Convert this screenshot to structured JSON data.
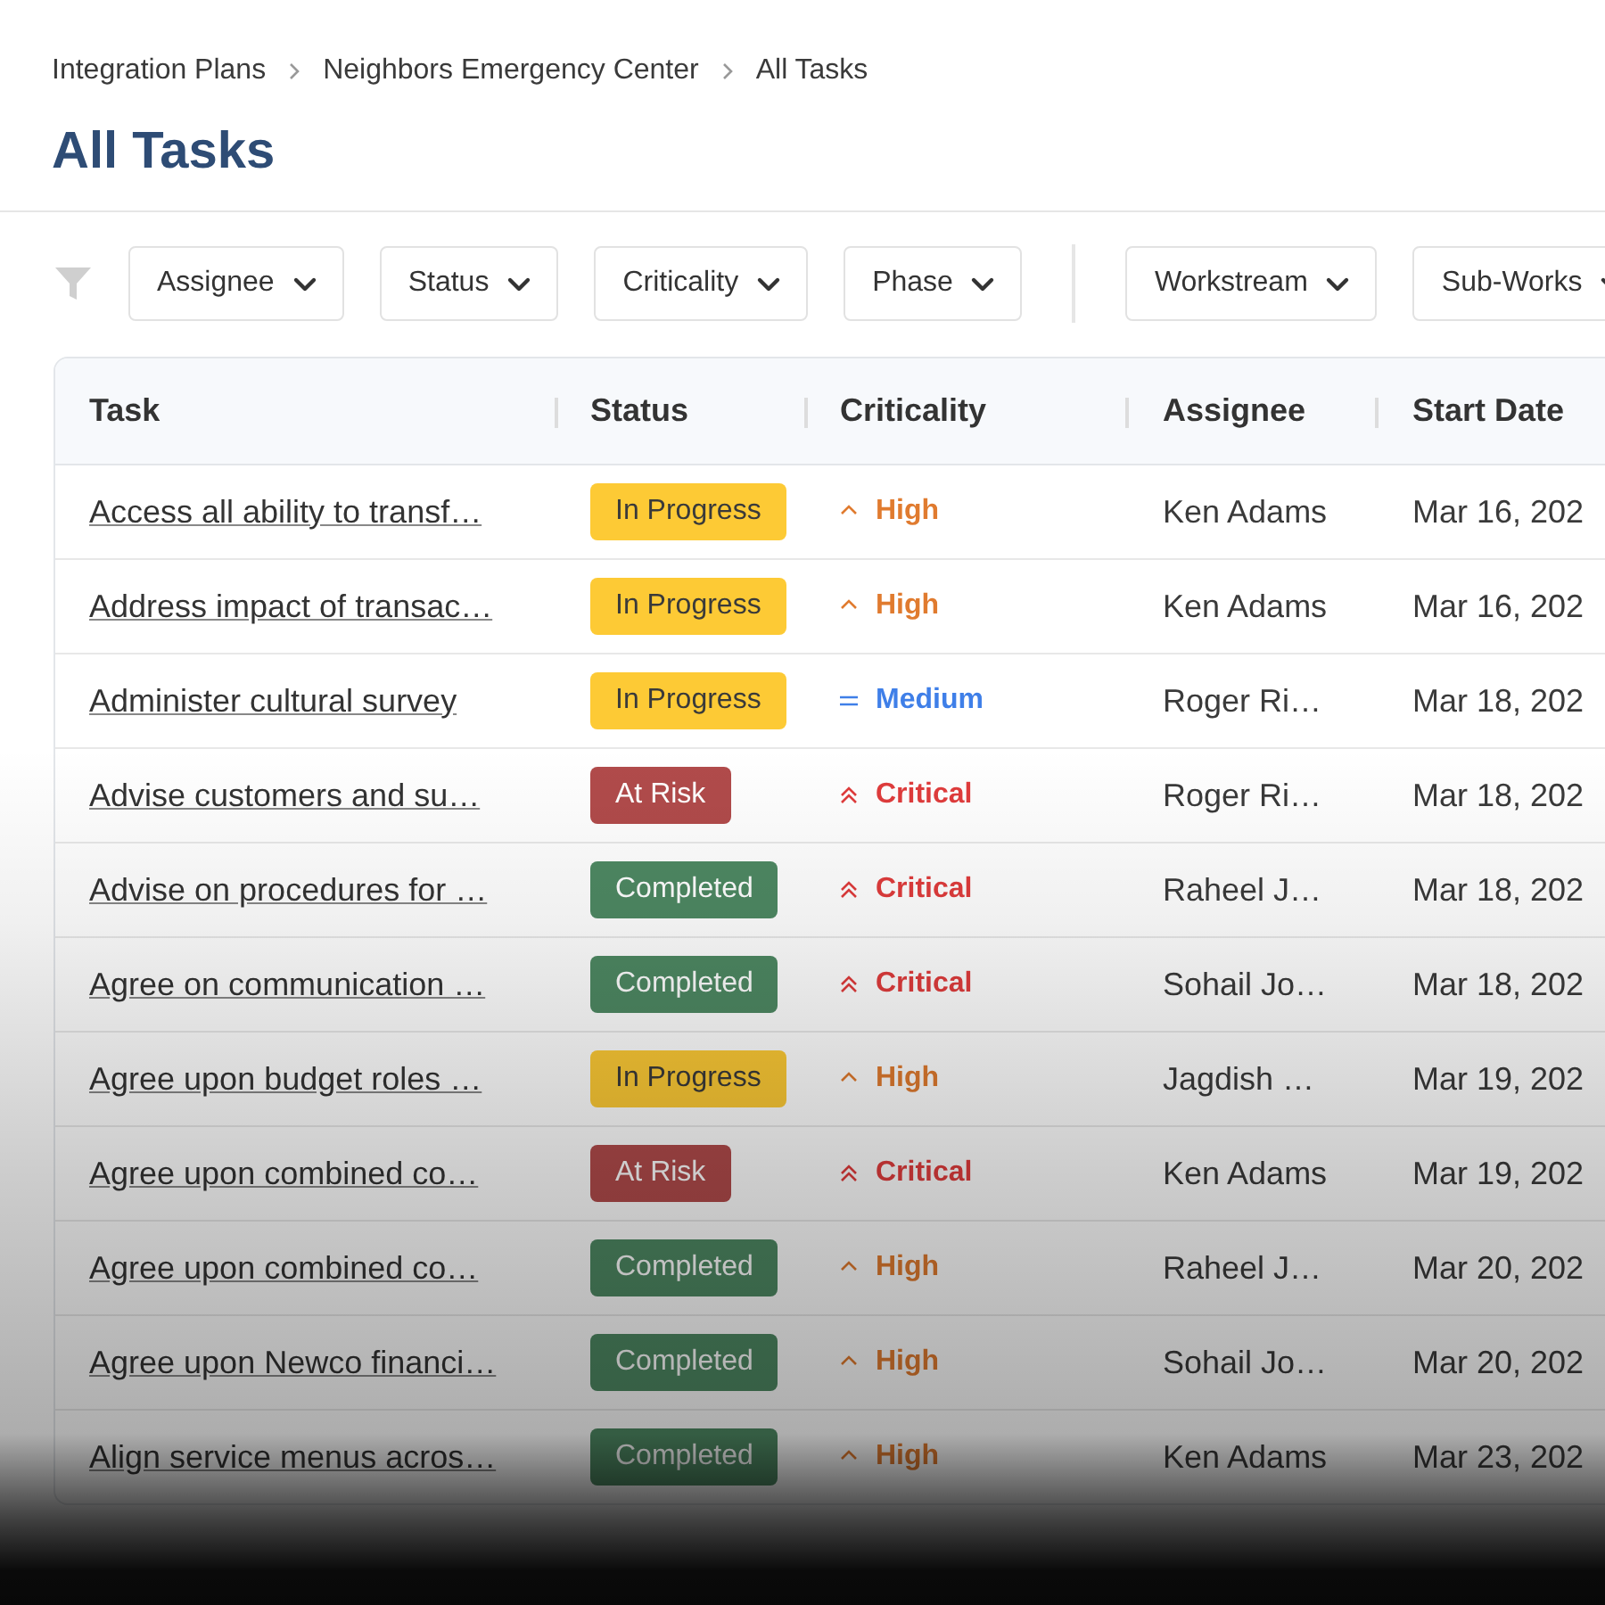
{
  "breadcrumb": [
    "Integration Plans",
    "Neighbors Emergency Center",
    "All Tasks"
  ],
  "title": "All Tasks",
  "filter_groups": [
    [
      "Assignee",
      "Status",
      "Criticality",
      "Phase"
    ],
    [
      "Workstream",
      "Sub-Works"
    ]
  ],
  "table": {
    "columns": [
      "Task",
      "Status",
      "Criticality",
      "Assignee",
      "Start Date"
    ],
    "rows": [
      {
        "task": "Access all ability to transf…",
        "status": {
          "label": "In Progress",
          "kind": "in_progress"
        },
        "criticality": {
          "label": "High",
          "kind": "high"
        },
        "assignee": "Ken Adams",
        "start_date": "Mar 16, 202"
      },
      {
        "task": "Address impact of transac…",
        "status": {
          "label": "In Progress",
          "kind": "in_progress"
        },
        "criticality": {
          "label": "High",
          "kind": "high"
        },
        "assignee": "Ken Adams",
        "start_date": "Mar 16, 202"
      },
      {
        "task": "Administer cultural survey",
        "status": {
          "label": "In Progress",
          "kind": "in_progress"
        },
        "criticality": {
          "label": "Medium",
          "kind": "medium"
        },
        "assignee": "Roger Ri…",
        "start_date": "Mar 18, 202"
      },
      {
        "task": "Advise customers and su…",
        "status": {
          "label": "At Risk",
          "kind": "at_risk"
        },
        "criticality": {
          "label": "Critical",
          "kind": "critical"
        },
        "assignee": "Roger Ri…",
        "start_date": "Mar 18, 202"
      },
      {
        "task": "Advise on procedures for …",
        "status": {
          "label": "Completed",
          "kind": "completed"
        },
        "criticality": {
          "label": "Critical",
          "kind": "critical"
        },
        "assignee": "Raheel J…",
        "start_date": "Mar 18, 202"
      },
      {
        "task": "Agree on communication …",
        "status": {
          "label": "Completed",
          "kind": "completed"
        },
        "criticality": {
          "label": "Critical",
          "kind": "critical"
        },
        "assignee": "Sohail Jo…",
        "start_date": "Mar 18, 202"
      },
      {
        "task": "Agree upon budget roles …",
        "status": {
          "label": "In Progress",
          "kind": "in_progress"
        },
        "criticality": {
          "label": "High",
          "kind": "high"
        },
        "assignee": "Jagdish …",
        "start_date": "Mar 19, 202"
      },
      {
        "task": "Agree upon combined co…",
        "status": {
          "label": "At Risk",
          "kind": "at_risk"
        },
        "criticality": {
          "label": "Critical",
          "kind": "critical"
        },
        "assignee": "Ken Adams",
        "start_date": "Mar 19, 202"
      },
      {
        "task": "Agree upon combined co…",
        "status": {
          "label": "Completed",
          "kind": "completed"
        },
        "criticality": {
          "label": "High",
          "kind": "high"
        },
        "assignee": "Raheel J…",
        "start_date": "Mar 20, 202"
      },
      {
        "task": "Agree upon Newco financi…",
        "status": {
          "label": "Completed",
          "kind": "completed"
        },
        "criticality": {
          "label": "High",
          "kind": "high"
        },
        "assignee": "Sohail Jo…",
        "start_date": "Mar 20, 202"
      },
      {
        "task": "Align service menus acros…",
        "status": {
          "label": "Completed",
          "kind": "completed"
        },
        "criticality": {
          "label": "High",
          "kind": "high"
        },
        "assignee": "Ken Adams",
        "start_date": "Mar 23, 202"
      }
    ]
  }
}
